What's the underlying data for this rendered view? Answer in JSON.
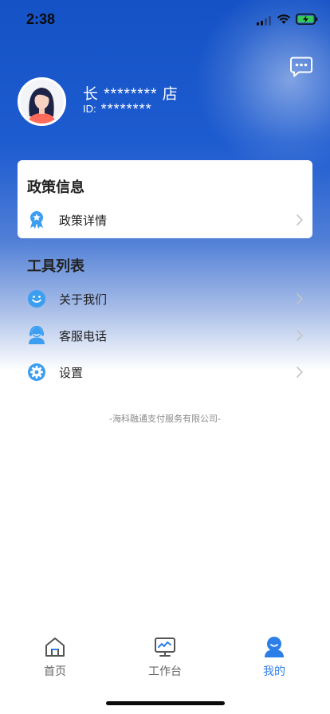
{
  "status_bar": {
    "time": "2:38"
  },
  "profile": {
    "store_name": "长 ******** 店",
    "id_label": "ID:",
    "id_value": "********"
  },
  "policy": {
    "title": "政策信息",
    "items": [
      {
        "label": "政策详情",
        "icon": "award-ribbon-icon"
      }
    ]
  },
  "tools": {
    "title": "工具列表",
    "items": [
      {
        "label": "关于我们",
        "icon": "smiley-icon"
      },
      {
        "label": "客服电话",
        "icon": "customer-service-icon"
      },
      {
        "label": "设置",
        "icon": "gear-icon"
      }
    ]
  },
  "footer": {
    "company": "-海科融通支付服务有限公司-"
  },
  "tab_bar": {
    "tabs": [
      {
        "label": "首页",
        "icon": "home-icon",
        "active": false
      },
      {
        "label": "工作台",
        "icon": "monitor-chart-icon",
        "active": false
      },
      {
        "label": "我的",
        "icon": "user-icon",
        "active": true
      }
    ]
  },
  "colors": {
    "header_blue": "#1452c6",
    "accent_blue": "#2d7fe8",
    "icon_blue": "#3b9ef0",
    "text_dark": "#222222",
    "text_muted": "#8a8a8a"
  }
}
